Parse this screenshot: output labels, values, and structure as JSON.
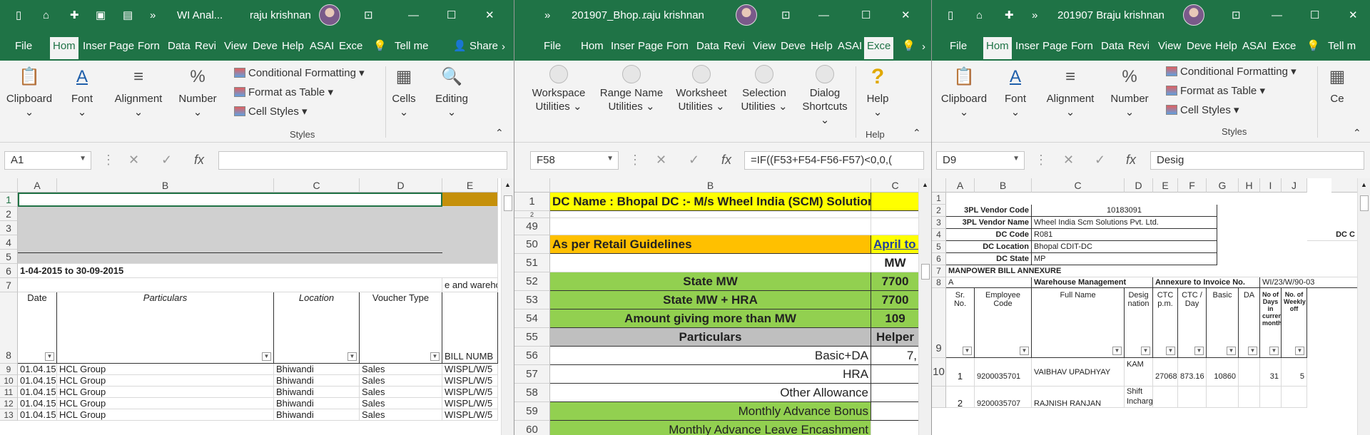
{
  "w1": {
    "qat": [
      "▯",
      "⌂",
      "✚",
      "💾",
      "⎙",
      "»"
    ],
    "title": "WI Anal...",
    "user": "raju krishnan",
    "tabs": [
      "File",
      "Hom",
      "Inser",
      "Page",
      "Forn",
      "Data",
      "Revi",
      "View",
      "Deve",
      "Help",
      "ASAI",
      "Exce",
      "Tell me",
      "Share"
    ],
    "ribbon": {
      "clipboard": "Clipboard",
      "font": "Font",
      "alignment": "Alignment",
      "number": "Number",
      "cond": "Conditional Formatting",
      "fmt_table": "Format as Table",
      "cell_styles": "Cell Styles",
      "styles": "Styles",
      "cells": "Cells",
      "editing": "Editing"
    },
    "namebox": "A1",
    "formula": "",
    "cols": [
      "A",
      "B",
      "C",
      "D",
      "E"
    ],
    "rows": [
      "1",
      "2",
      "3",
      "4",
      "5",
      "6",
      "7",
      "8",
      "9",
      "10",
      "11",
      "12",
      "13"
    ],
    "row6": "1-04-2015 to 30-09-2015",
    "row7": "e and wareho",
    "headers": [
      "Date",
      "Particulars",
      "Location",
      "Voucher Type",
      "BILL NUMB"
    ],
    "data": [
      [
        "01.04.15",
        "HCL Group",
        "Bhiwandi",
        "Sales",
        "WISPL/W/5"
      ],
      [
        "01.04.15",
        "HCL Group",
        "Bhiwandi",
        "Sales",
        "WISPL/W/5"
      ],
      [
        "01.04.15",
        "HCL Group",
        "Bhiwandi",
        "Sales",
        "WISPL/W/5"
      ],
      [
        "01.04.15",
        "HCL Group",
        "Bhiwandi",
        "Sales",
        "WISPL/W/5"
      ],
      [
        "01.04.15",
        "HCL Group",
        "Bhiwandi",
        "Sales",
        "WISPL/W/5"
      ]
    ]
  },
  "w2": {
    "title": "201907_Bhop...",
    "user": "raju krishnan",
    "tabs": [
      "File",
      "Hom",
      "Inser",
      "Page",
      "Forn",
      "Data",
      "Revi",
      "View",
      "Deve",
      "Help",
      "ASAI",
      "Exce"
    ],
    "ribbon": {
      "ws": "Workspace",
      "rn": "Range Name",
      "wk": "Worksheet",
      "sel": "Selection",
      "dlg": "Dialog",
      "util": "Utilities",
      "short": "Shortcuts",
      "help": "Help",
      "grp": "Help"
    },
    "namebox": "F58",
    "formula": "=IF((F53+F54-F56-F57)<0,0,(",
    "cols": [
      "B",
      "C"
    ],
    "rows": [
      {
        "n": "1",
        "b": "DC Name : Bhopal DC :- M/s Wheel India (SCM) Solutions",
        "c": "",
        "bg": "#ffff00",
        "cbg": "#ffff00"
      },
      {
        "n": "2",
        "b": "",
        "c": "",
        "bg": "#fff",
        "cbg": "#fff"
      },
      {
        "n": "49",
        "b": "",
        "c": "",
        "bg": "#fff",
        "cbg": "#fff"
      },
      {
        "n": "50",
        "b": "As per Retail Guidelines",
        "c": "April to June",
        "bg": "#ffc000",
        "cbg": "#ffff00"
      },
      {
        "n": "51",
        "b": "",
        "c": "MW",
        "bg": "#fff",
        "cbg": "#fff"
      },
      {
        "n": "52",
        "b": "State MW",
        "c": "7700",
        "bg": "#92d050",
        "cbg": "#92d050"
      },
      {
        "n": "53",
        "b": "State MW + HRA",
        "c": "7700",
        "bg": "#92d050",
        "cbg": "#92d050"
      },
      {
        "n": "54",
        "b": "Amount giving more than MW",
        "c": "109",
        "bg": "#92d050",
        "cbg": "#92d050"
      },
      {
        "n": "55",
        "b": "Particulars",
        "c": "Helper",
        "bg": "#bfbfbf",
        "cbg": "#bfbfbf"
      },
      {
        "n": "56",
        "b": "Basic+DA",
        "c": "7,",
        "bg": "#fff",
        "cbg": "#fff"
      },
      {
        "n": "57",
        "b": "HRA",
        "c": "",
        "bg": "#fff",
        "cbg": "#fff"
      },
      {
        "n": "58",
        "b": "Other Allowance",
        "c": "",
        "bg": "#fff",
        "cbg": "#fff"
      },
      {
        "n": "59",
        "b": "Monthly Advance Bonus",
        "c": "",
        "bg": "#92d050",
        "cbg": "#fff"
      },
      {
        "n": "60",
        "b": "Monthly Advance Leave Encashment",
        "c": "",
        "bg": "#92d050",
        "cbg": "#fff"
      }
    ]
  },
  "w3": {
    "title": "201907 B...",
    "user": "raju krishnan",
    "tabs": [
      "File",
      "Hom",
      "Inser",
      "Page",
      "Forn",
      "Data",
      "Revi",
      "View",
      "Deve",
      "Help",
      "ASAI",
      "Exce",
      "Tell m"
    ],
    "ribbon": {
      "clipboard": "Clipboard",
      "font": "Font",
      "alignment": "Alignment",
      "number": "Number",
      "cond": "Conditional Formatting",
      "fmt_table": "Format as Table",
      "cell_styles": "Cell Styles",
      "styles": "Styles",
      "ce": "Ce"
    },
    "namebox": "D9",
    "formula": "Desig",
    "cols": [
      "A",
      "B",
      "C",
      "D",
      "E",
      "F",
      "G",
      "H",
      "I",
      "J"
    ],
    "info": [
      [
        "3PL Vendor Code",
        "10183091"
      ],
      [
        "3PL Vendor Name",
        "Wheel India Scm Solutions Pvt. Ltd."
      ],
      [
        "DC Code",
        "R081"
      ],
      [
        "DC Location",
        "Bhopal CDIT-DC"
      ],
      [
        "DC State",
        "MP"
      ]
    ],
    "dc_c": "DC C",
    "row7": "MANPOWER BILL ANNEXURE",
    "row8": {
      "a": "A",
      "wm": "Warehouse Management",
      "ann": "Annexure to Invoice No.",
      "inv": "WI/23/W/90-03"
    },
    "hdr": [
      "Sr. No.",
      "Employee Code",
      "Full Name",
      "Desig nation",
      "CTC p.m.",
      "CTC / Day",
      "Basic",
      "DA",
      "No of Days in current month",
      "No. of Weekly off"
    ],
    "r10": [
      "1",
      "9200035701",
      "VAIBHAV UPADHYAY",
      "KAM",
      "27068",
      "873.16",
      "10860",
      "",
      "31",
      "5"
    ],
    "r11": [
      "2",
      "9200035707",
      "RAJNISH RANJAN",
      "Shift Incharge",
      "",
      "",
      "",
      "",
      "",
      ""
    ],
    "rownums": [
      "1",
      "2",
      "3",
      "4",
      "5",
      "6",
      "7",
      "8",
      "9",
      "10"
    ]
  }
}
